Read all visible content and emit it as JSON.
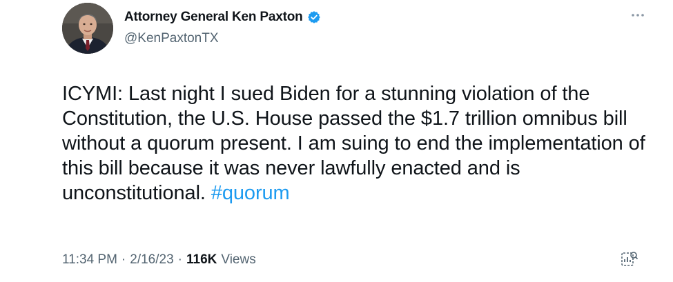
{
  "author": {
    "display_name": "Attorney General Ken Paxton",
    "handle": "@KenPaxtonTX",
    "verified": true,
    "verified_color": "#1d9bf0"
  },
  "tweet": {
    "text_before": "ICYMI: Last night I sued Biden for a stunning violation of the Constitution, the U.S. House passed the $1.7 trillion omnibus bill without a quorum present. I am suing to end the implementation of this bill because it was never lawfully enacted and is unconstitutional. ",
    "hashtag": "#quorum",
    "hashtag_color": "#1d9bf0"
  },
  "meta": {
    "time": "11:34 PM",
    "separator": "·",
    "date": "2/16/23",
    "views_count": "116K",
    "views_label": "Views"
  },
  "icons": {
    "verified": "verified-badge-icon",
    "more": "more-options-icon",
    "analytics": "tweet-analytics-icon"
  }
}
